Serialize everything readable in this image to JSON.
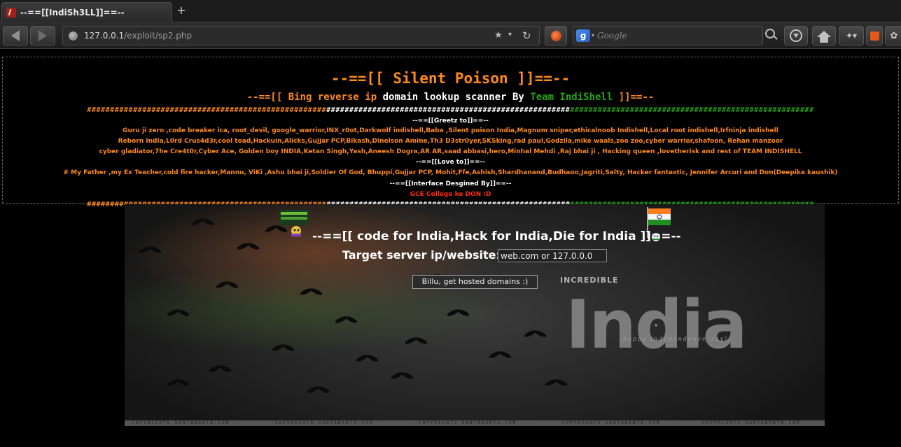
{
  "browser": {
    "tab_title": "--==[[IndiSh3LL]]==--",
    "new_tab": "+",
    "url_host": "127.0.0.1",
    "url_path": "/exploit/sp2.php",
    "search_placeholder": "Google",
    "search_engine_letter": "g",
    "icons": [
      "back-arrow",
      "forward-arrow",
      "globe",
      "star",
      "reload",
      "search-engine",
      "download",
      "home",
      "addon",
      "orange-addon",
      "settings"
    ]
  },
  "page": {
    "title": "--==[[ Silent Poison ]]==--",
    "subtitle_parts": {
      "a": "--==[[ Bing reverse ip ",
      "b": "domain lookup scanner By ",
      "c": "Team IndiShell",
      "d": " ]]==--"
    },
    "hash_orange": "####################################################",
    "hash_white": "#####################################################",
    "hash_green": "#####################################################",
    "greetz_heading": "--==[[Greetz to]]==--",
    "greetz_line1": "Guru ji zero ,code breaker ica, root_devil, google_warrior,INX_r0ot,Darkwolf indishell,Baba ,Silent poison India,Magnum sniper,ethicalnoob Indishell,Local root indishell,Irfninja indishell",
    "greetz_line2": "Reborn India,L0rd Crus4d3r,cool toad,Hackuin,Alicks,Gujjar PCP,Bikash,Dinelson Amine,Th3 D3str0yer,SKSking,rad paul,Godzila,mike waals,zoo zoo,cyber warrior,shafoon, Rehan manzoor",
    "greetz_line3": "cyber gladiator,7he Cre4t0r,Cyber Ace, Golden boy INDIA,Ketan Singh,Yash,Aneesh Dogra,AR AR,saad abbasi,hero,Minhal Mehdi ,Raj bhai ji , Hacking queen ,lovetherisk and rest of TEAM INDISHELL",
    "love_heading": "--==[[Love to]]==--",
    "love_line": "# My Father ,my Ex Teacher,cold fire hacker,Mannu, ViKi ,Ashu bhai ji,Soldier Of God, Bhuppi,Gujjar PCP, Mohit,Ffe,Ashish,Shardhanand,Budhaoo,Jagriti,Salty, Hacker fantastic, Jennifer Arcuri and Don(Deepika kaushik)",
    "design_heading": "--==[[Interface Desgined By]]==--",
    "design_line": "GCE College ke DON :D"
  },
  "banner": {
    "slogan": "--==[[ code for India,Hack for India,Die for India ]]==--",
    "target_label": "Target server ip/website:",
    "target_value": "web.com or 127.0.0.0",
    "submit_label": "Billu, get hosted domains :)",
    "brand_small": "INCREDIBLE",
    "brand_big": "India",
    "tagline": "happy independence day!",
    "footer": "COPYRIGHTS SANTABANTA.COM"
  },
  "colors": {
    "orange": "#ff8a1c",
    "green": "#26a418",
    "red": "#ff2a10"
  }
}
